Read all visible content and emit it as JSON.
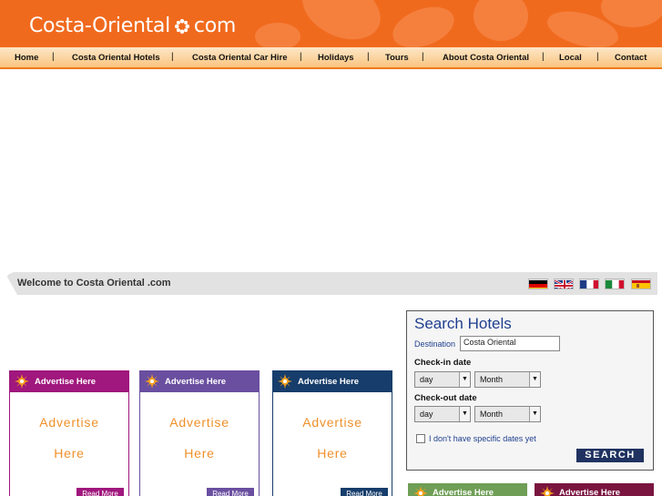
{
  "header": {
    "logo_left": "Costa-Oriental",
    "logo_right": "com"
  },
  "nav": {
    "items": [
      "Home",
      "Costa Oriental Hotels",
      "Costa Oriental Car Hire",
      "Holidays",
      "Tours",
      "About Costa Oriental",
      "Local",
      "Contact"
    ],
    "separator": "|"
  },
  "welcome": {
    "text": "Welcome to Costa Oriental .com",
    "flags": [
      "german-flag-icon",
      "uk-flag-icon",
      "french-flag-icon",
      "italian-flag-icon",
      "spanish-flag-icon"
    ]
  },
  "search": {
    "title": "Search Hotels",
    "destination_label": "Destination",
    "destination_value": "Costa Oriental",
    "checkin_label": "Check-in date",
    "checkout_label": "Check-out date",
    "day_value": "day",
    "month_value": "Month",
    "no_dates_label": "I don't have specific dates yet",
    "button_label": "SEARCH"
  },
  "ads": [
    {
      "title": "Advertise Here",
      "line1": "Advertise",
      "line2": "Here",
      "more": "Read More",
      "color": "#a0177d"
    },
    {
      "title": "Advertise Here",
      "line1": "Advertise",
      "line2": "Here",
      "more": "Read More",
      "color": "#6a4fa0"
    },
    {
      "title": "Advertise Here",
      "line1": "Advertise",
      "line2": "Here",
      "more": "Read More",
      "color": "#163d6b"
    }
  ],
  "ads_small": [
    {
      "title": "Advertise Here",
      "color": "#6f9e56"
    },
    {
      "title": "Advertise Here",
      "color": "#7a1540"
    }
  ],
  "colors": {
    "header": "#f06a1e",
    "accent": "#f0902a",
    "search_title": "#1f3f8f",
    "search_button": "#1f3260"
  }
}
